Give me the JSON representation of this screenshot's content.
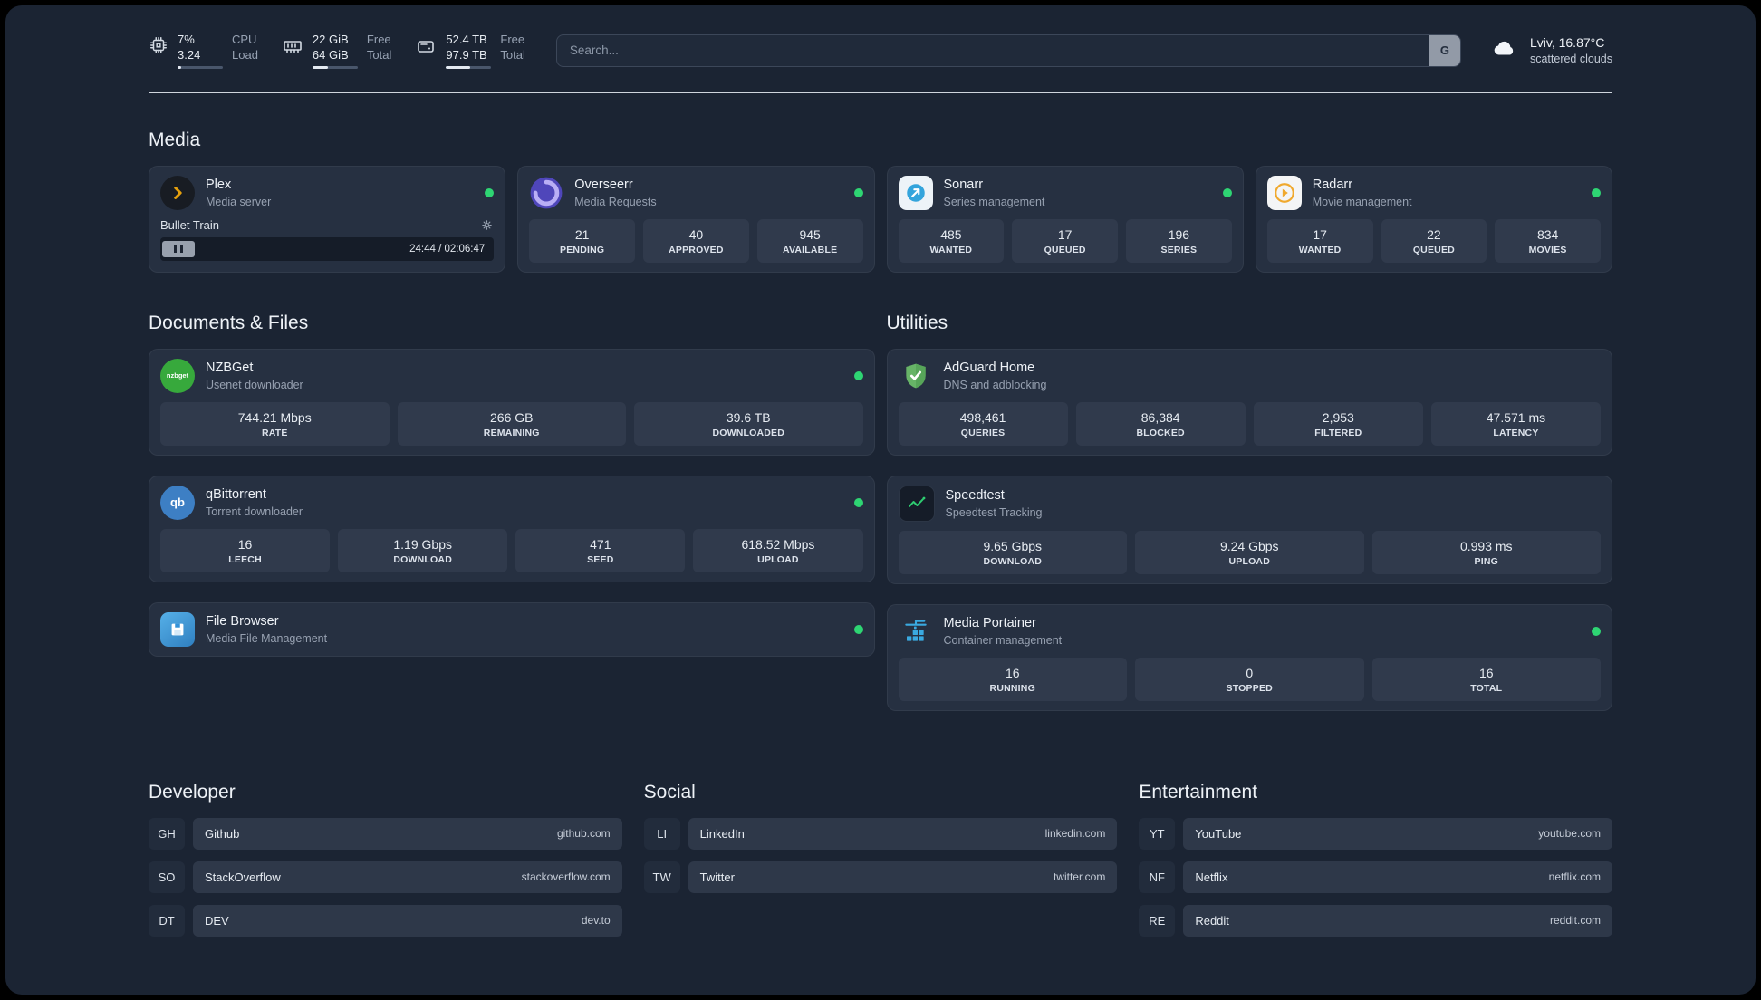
{
  "colors": {
    "background": "#1b2433",
    "card": "#263041",
    "tile": "#303a4c",
    "status_online": "#2ed573",
    "plex_accent": "#e5a00d",
    "adguard_green": "#67b467",
    "portainer_blue": "#3aa9e0"
  },
  "icons": {
    "cpu": "chip-icon",
    "memory": "ram-icon",
    "disk": "drive-icon",
    "weather": "cloud-icon",
    "plex": "chevron-right-icon",
    "overseerr": "swirl-icon",
    "sonarr": "arrow-icon",
    "radarr": "play-icon",
    "nzbget": "nzbget-badge",
    "qbittorrent": "qb-badge",
    "filebrowser": "floppy-icon",
    "adguard": "shield-check-icon",
    "speedtest": "line-graph-icon",
    "portainer": "container-crane-icon",
    "plex_settings": "gear-icon",
    "plex_pause": "pause-icon"
  },
  "topbar": {
    "cpu": {
      "line1": "7%",
      "line2": "3.24",
      "label1": "CPU",
      "label2": "Load"
    },
    "memory": {
      "line1": "22 GiB",
      "line2": "64 GiB",
      "label1": "Free",
      "label2": "Total"
    },
    "disk": {
      "line1": "52.4 TB",
      "line2": "97.9 TB",
      "label1": "Free",
      "label2": "Total"
    },
    "search": {
      "placeholder": "Search...",
      "button_label": "G"
    },
    "weather": {
      "location": "Lviv, 16.87°C",
      "condition": "scattered clouds"
    }
  },
  "media": {
    "title": "Media",
    "plex": {
      "name": "Plex",
      "subtitle": "Media server",
      "now_playing": "Bullet Train",
      "time": "24:44 / 02:06:47"
    },
    "overseerr": {
      "name": "Overseerr",
      "subtitle": "Media Requests",
      "stats": [
        {
          "value": "21",
          "label": "PENDING"
        },
        {
          "value": "40",
          "label": "APPROVED"
        },
        {
          "value": "945",
          "label": "AVAILABLE"
        }
      ]
    },
    "sonarr": {
      "name": "Sonarr",
      "subtitle": "Series management",
      "stats": [
        {
          "value": "485",
          "label": "WANTED"
        },
        {
          "value": "17",
          "label": "QUEUED"
        },
        {
          "value": "196",
          "label": "SERIES"
        }
      ]
    },
    "radarr": {
      "name": "Radarr",
      "subtitle": "Movie management",
      "stats": [
        {
          "value": "17",
          "label": "WANTED"
        },
        {
          "value": "22",
          "label": "QUEUED"
        },
        {
          "value": "834",
          "label": "MOVIES"
        }
      ]
    }
  },
  "documents": {
    "title": "Documents & Files",
    "nzbget": {
      "name": "NZBGet",
      "subtitle": "Usenet downloader",
      "badge_text": "nzbget",
      "stats": [
        {
          "value": "744.21 Mbps",
          "label": "RATE"
        },
        {
          "value": "266 GB",
          "label": "REMAINING"
        },
        {
          "value": "39.6 TB",
          "label": "DOWNLOADED"
        }
      ]
    },
    "qbittorrent": {
      "name": "qBittorrent",
      "subtitle": "Torrent downloader",
      "badge_text": "qb",
      "stats": [
        {
          "value": "16",
          "label": "LEECH"
        },
        {
          "value": "1.19 Gbps",
          "label": "DOWNLOAD"
        },
        {
          "value": "471",
          "label": "SEED"
        },
        {
          "value": "618.52 Mbps",
          "label": "UPLOAD"
        }
      ]
    },
    "filebrowser": {
      "name": "File Browser",
      "subtitle": "Media File Management"
    }
  },
  "utilities": {
    "title": "Utilities",
    "adguard": {
      "name": "AdGuard Home",
      "subtitle": "DNS and adblocking",
      "stats": [
        {
          "value": "498,461",
          "label": "QUERIES"
        },
        {
          "value": "86,384",
          "label": "BLOCKED"
        },
        {
          "value": "2,953",
          "label": "FILTERED"
        },
        {
          "value": "47.571 ms",
          "label": "LATENCY"
        }
      ]
    },
    "speedtest": {
      "name": "Speedtest",
      "subtitle": "Speedtest Tracking",
      "stats": [
        {
          "value": "9.65 Gbps",
          "label": "DOWNLOAD"
        },
        {
          "value": "9.24 Gbps",
          "label": "UPLOAD"
        },
        {
          "value": "0.993 ms",
          "label": "PING"
        }
      ]
    },
    "portainer": {
      "name": "Media Portainer",
      "subtitle": "Container management",
      "stats": [
        {
          "value": "16",
          "label": "RUNNING"
        },
        {
          "value": "0",
          "label": "STOPPED"
        },
        {
          "value": "16",
          "label": "TOTAL"
        }
      ]
    }
  },
  "bookmarks": {
    "developer": {
      "title": "Developer",
      "items": [
        {
          "abbr": "GH",
          "name": "Github",
          "url": "github.com"
        },
        {
          "abbr": "SO",
          "name": "StackOverflow",
          "url": "stackoverflow.com"
        },
        {
          "abbr": "DT",
          "name": "DEV",
          "url": "dev.to"
        }
      ]
    },
    "social": {
      "title": "Social",
      "items": [
        {
          "abbr": "LI",
          "name": "LinkedIn",
          "url": "linkedin.com"
        },
        {
          "abbr": "TW",
          "name": "Twitter",
          "url": "twitter.com"
        }
      ]
    },
    "entertainment": {
      "title": "Entertainment",
      "items": [
        {
          "abbr": "YT",
          "name": "YouTube",
          "url": "youtube.com"
        },
        {
          "abbr": "NF",
          "name": "Netflix",
          "url": "netflix.com"
        },
        {
          "abbr": "RE",
          "name": "Reddit",
          "url": "reddit.com"
        }
      ]
    }
  }
}
